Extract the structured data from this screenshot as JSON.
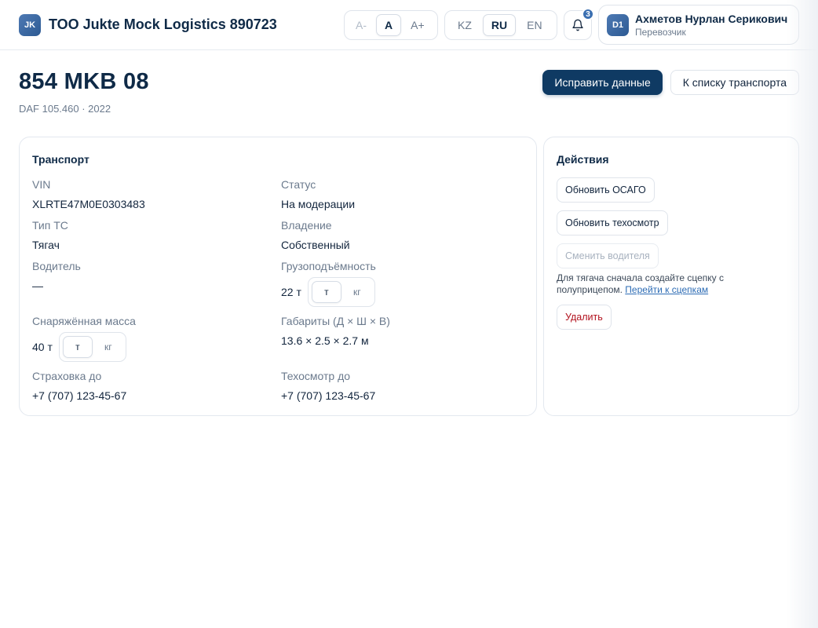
{
  "header": {
    "logo_text": "JK",
    "company": "TOO Jukte Mock Logistics 890723",
    "font_sizes": [
      {
        "label": "A-",
        "state": "disabled"
      },
      {
        "label": "A",
        "state": "active"
      },
      {
        "label": "A+",
        "state": "normal"
      }
    ],
    "languages": [
      {
        "label": "KZ",
        "state": "normal"
      },
      {
        "label": "RU",
        "state": "active"
      },
      {
        "label": "EN",
        "state": "normal"
      }
    ],
    "notifications_count": "3",
    "user": {
      "initials": "D1",
      "name": "Ахметов Нурлан Серикович",
      "role": "Перевозчик"
    }
  },
  "page": {
    "title": "854 MKB 08",
    "subtitle": "DAF 105.460 · 2022",
    "edit_button": "Исправить данные",
    "back_button": "К списку транспорта"
  },
  "transport": {
    "title": "Транспорт",
    "vin": {
      "label": "VIN",
      "value": "XLRTE47M0E0303483"
    },
    "status": {
      "label": "Статус",
      "value": "На модерации"
    },
    "type": {
      "label": "Тип ТС",
      "value": "Тягач"
    },
    "ownership": {
      "label": "Владение",
      "value": "Собственный"
    },
    "driver": {
      "label": "Водитель",
      "value": "—"
    },
    "capacity": {
      "label": "Грузоподъёмность",
      "value": "22 т",
      "unit_t": "т",
      "unit_kg": "кг"
    },
    "curb_weight": {
      "label": "Снаряжённая масса",
      "value": "40 т",
      "unit_t": "т",
      "unit_kg": "кг"
    },
    "dimensions": {
      "label": "Габариты (Д × Ш × В)",
      "value": "13.6 × 2.5 × 2.7 м"
    },
    "insurance": {
      "label": "Страховка до",
      "value": "+7 (707) 123-45-67"
    },
    "inspection": {
      "label": "Техосмотр до",
      "value": "+7 (707) 123-45-67"
    }
  },
  "actions": {
    "title": "Действия",
    "update_osago": "Обновить ОСАГО",
    "update_inspection": "Обновить техосмотр",
    "change_driver": "Сменить водителя",
    "hint_text": "Для тягача сначала создайте сцепку с полуприцепом. ",
    "hint_link": "Перейти к сцепкам",
    "delete": "Удалить"
  },
  "colors": {
    "primary": "#0f3a63",
    "accent": "#3b6fb1",
    "danger": "#b2121e"
  }
}
